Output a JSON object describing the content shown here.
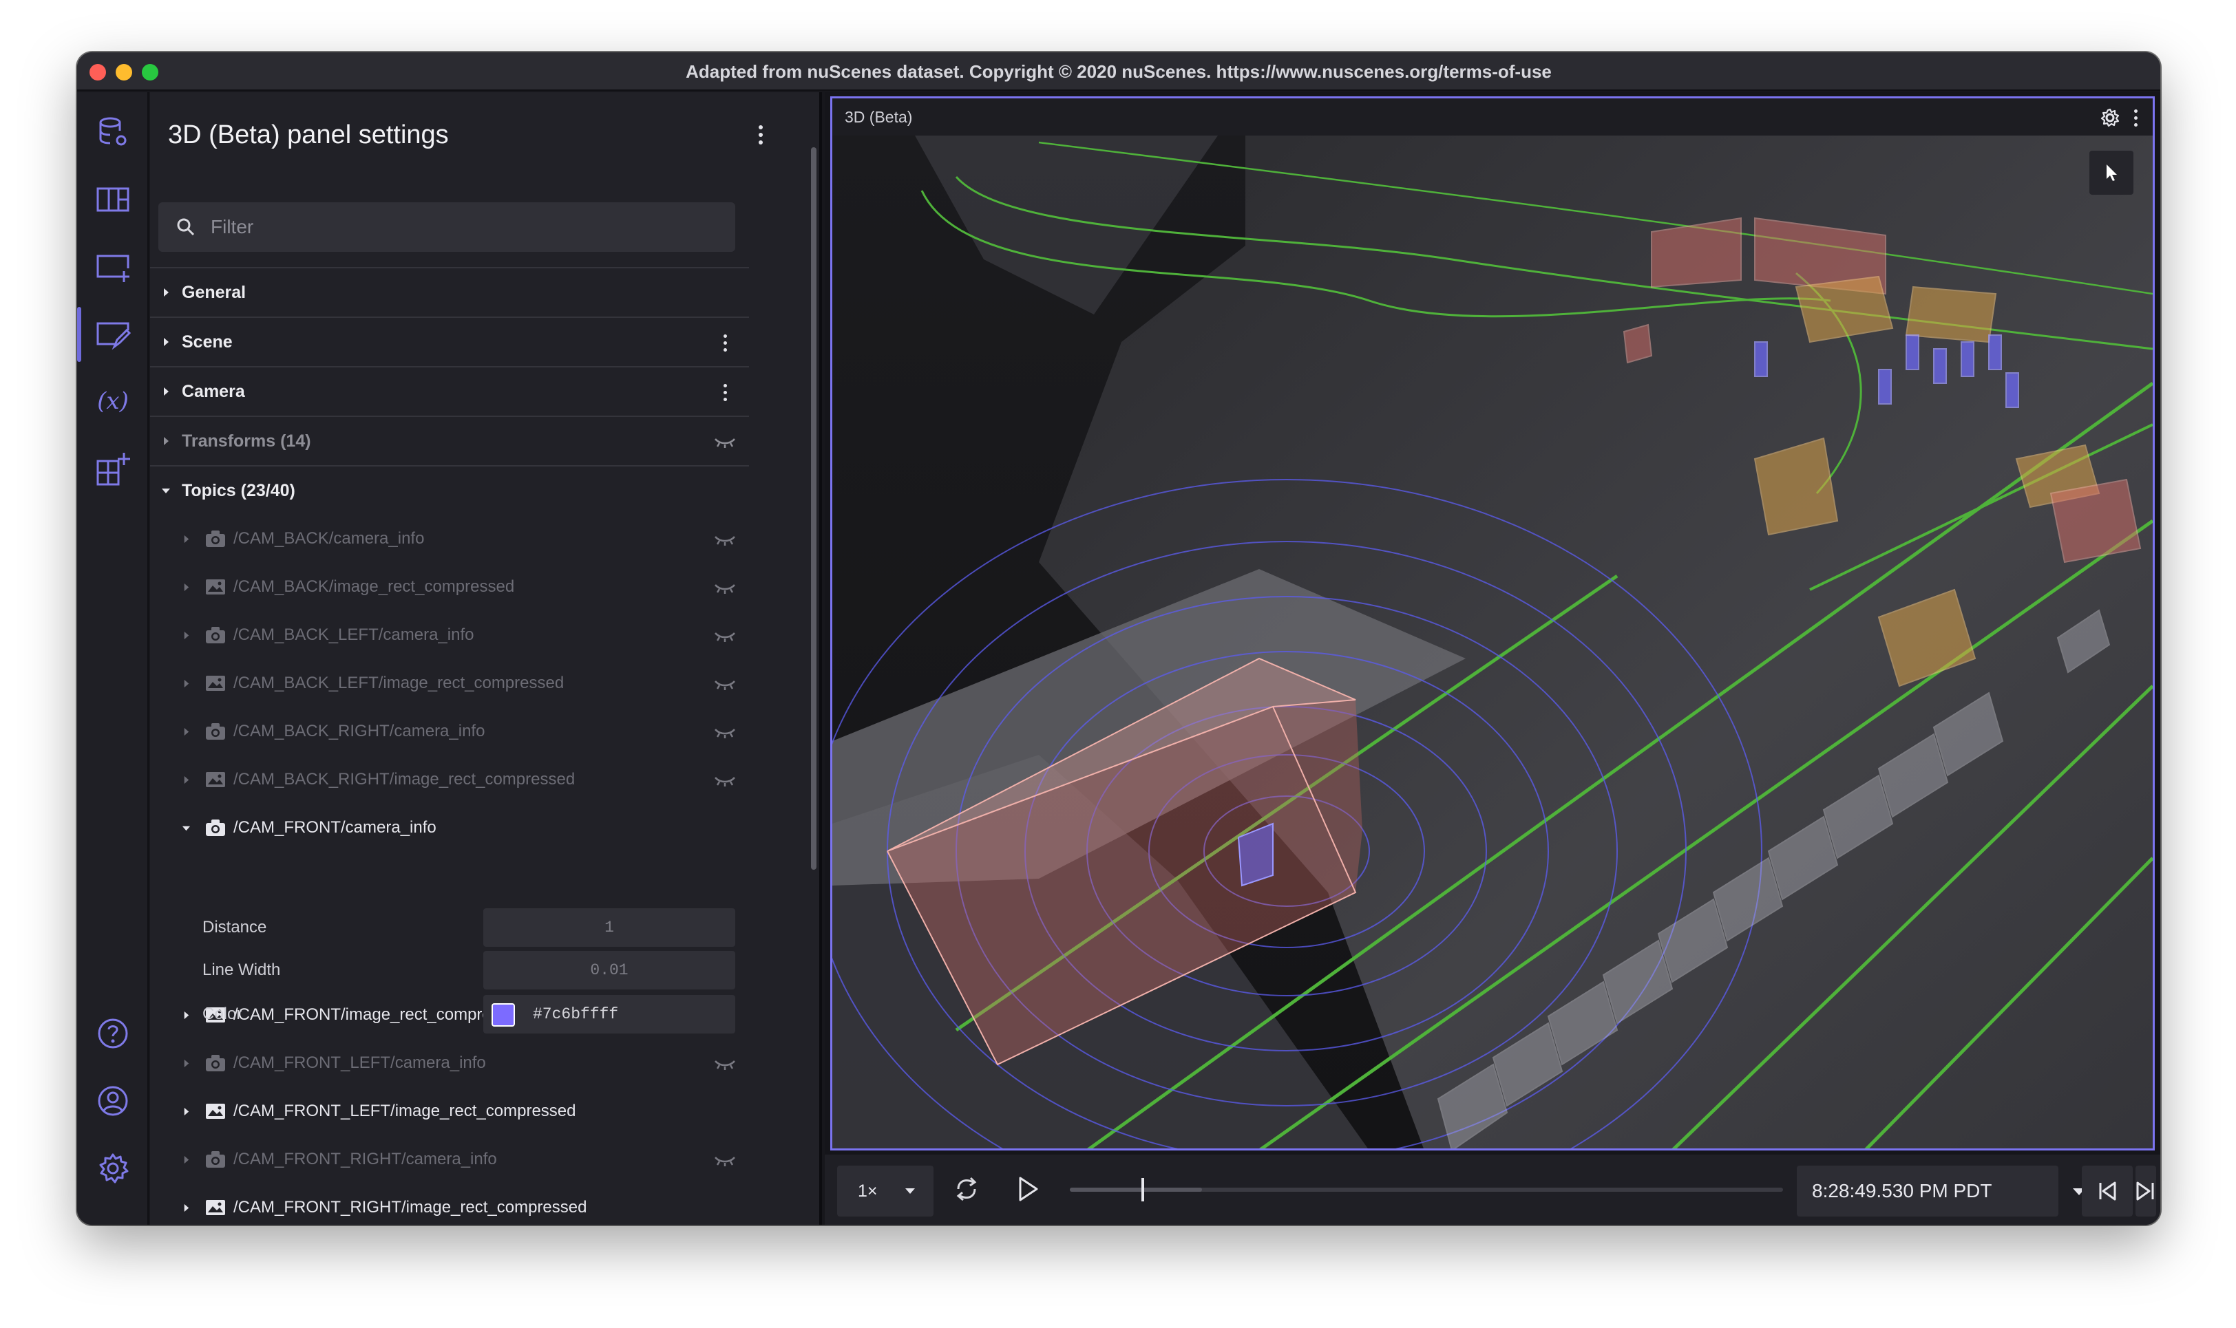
{
  "window": {
    "title": "Adapted from nuScenes dataset. Copyright © 2020 nuScenes. https://www.nuscenes.org/terms-of-use"
  },
  "rail": {
    "items": [
      {
        "icon": "database-settings-icon"
      },
      {
        "icon": "layout-icon"
      },
      {
        "icon": "add-panel-icon"
      },
      {
        "icon": "panel-settings-icon"
      },
      {
        "icon": "variables-icon"
      },
      {
        "icon": "extensions-icon"
      },
      {
        "icon": "help-icon"
      },
      {
        "icon": "account-icon"
      },
      {
        "icon": "settings-icon"
      }
    ],
    "variables_glyph": "(x)"
  },
  "settings": {
    "title": "3D (Beta) panel settings",
    "filter_placeholder": "Filter",
    "sections": [
      {
        "label": "General"
      },
      {
        "label": "Scene"
      },
      {
        "label": "Camera"
      },
      {
        "label": "Transforms (14)"
      },
      {
        "label": "Topics (23/40)"
      }
    ],
    "topics": [
      {
        "label": "/CAM_BACK/camera_info",
        "kind": "camera",
        "visible": false
      },
      {
        "label": "/CAM_BACK/image_rect_compressed",
        "kind": "image",
        "visible": false
      },
      {
        "label": "/CAM_BACK_LEFT/camera_info",
        "kind": "camera",
        "visible": false
      },
      {
        "label": "/CAM_BACK_LEFT/image_rect_compressed",
        "kind": "image",
        "visible": false
      },
      {
        "label": "/CAM_BACK_RIGHT/camera_info",
        "kind": "camera",
        "visible": false
      },
      {
        "label": "/CAM_BACK_RIGHT/image_rect_compressed",
        "kind": "image",
        "visible": false
      },
      {
        "label": "/CAM_FRONT/camera_info",
        "kind": "camera",
        "visible": true
      },
      {
        "label": "/CAM_FRONT/image_rect_compressed",
        "kind": "image",
        "visible": true
      },
      {
        "label": "/CAM_FRONT_LEFT/camera_info",
        "kind": "camera",
        "visible": false
      },
      {
        "label": "/CAM_FRONT_LEFT/image_rect_compressed",
        "kind": "image",
        "visible": true
      },
      {
        "label": "/CAM_FRONT_RIGHT/camera_info",
        "kind": "camera",
        "visible": false
      },
      {
        "label": "/CAM_FRONT_RIGHT/image_rect_compressed",
        "kind": "image",
        "visible": true
      }
    ],
    "fields": {
      "distance_label": "Distance",
      "distance_value": "1",
      "line_width_label": "Line Width",
      "line_width_value": "0.01",
      "color_label": "Color",
      "color_value": "#7c6bffff",
      "color_hex": "#7c6bff"
    }
  },
  "panel": {
    "title": "3D (Beta)"
  },
  "playback": {
    "speed": "1×",
    "time": "8:28:49.530 PM PDT",
    "progress": 0.1
  },
  "colors": {
    "accent": "#7b74f0",
    "lane": "#4fb23a",
    "pedestrian_box": "#6f6bff",
    "vehicle_box_red": "#d8706a",
    "vehicle_box_orange": "#d9a24a",
    "barrier_box": "#c8c8d2"
  }
}
